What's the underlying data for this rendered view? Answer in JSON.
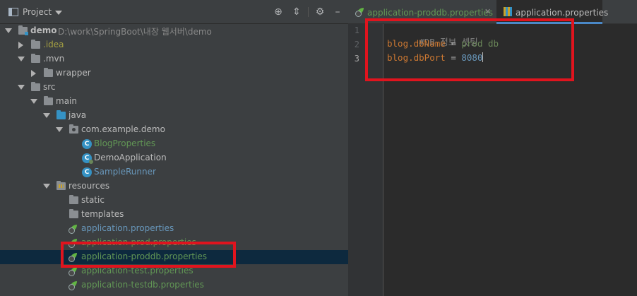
{
  "project_panel": {
    "title": "Project",
    "tools": [
      "locate-icon",
      "collapse-icon",
      "gear-icon",
      "minimize-icon"
    ]
  },
  "tree": {
    "root": {
      "label": "demo",
      "path": "D:\\work\\SpringBoot\\내장 웹서버\\demo"
    },
    "items": [
      {
        "label": ".idea"
      },
      {
        "label": ".mvn"
      },
      {
        "label": "wrapper"
      },
      {
        "label": "src"
      },
      {
        "label": "main"
      },
      {
        "label": "java"
      },
      {
        "label": "com.example.demo"
      },
      {
        "label": "BlogProperties"
      },
      {
        "label": "DemoApplication"
      },
      {
        "label": "SampleRunner"
      },
      {
        "label": "resources"
      },
      {
        "label": "static"
      },
      {
        "label": "templates"
      },
      {
        "label": "application.properties"
      },
      {
        "label": "application-prod.properties"
      },
      {
        "label": "application-proddb.properties"
      },
      {
        "label": "application-test.properties"
      },
      {
        "label": "application-testdb.properties"
      }
    ]
  },
  "editor": {
    "tabs": [
      {
        "label": "application-proddb.properties",
        "close": "✕",
        "active": false
      },
      {
        "label": "application.properties",
        "active": true
      }
    ],
    "lines": [
      {
        "number": "1",
        "comment": "#DB 정보 셋팅"
      },
      {
        "number": "2",
        "key": "blog.dbName",
        "eq": " = ",
        "value": "prod db"
      },
      {
        "number": "3",
        "key": "blog.dbPort",
        "eq": " = ",
        "value": "8080"
      }
    ]
  },
  "colors": {
    "highlight_box": "#e0141e",
    "selection": "#0d293e",
    "accent": "#4a88c7"
  }
}
